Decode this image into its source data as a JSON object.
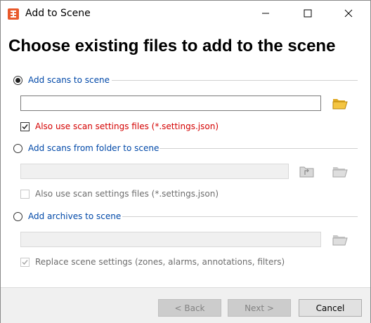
{
  "window": {
    "title": "Add to Scene",
    "app_icon": "app-logo-icon",
    "controls": [
      "minimize-icon",
      "maximize-icon",
      "close-icon"
    ]
  },
  "heading": "Choose existing files to add to the scene",
  "section_scans": {
    "label": "Add scans to scene",
    "selected": true,
    "path_value": "",
    "browse_icon": "folder-open-icon",
    "settings_checkbox": {
      "label": "Also use scan settings files (*.settings.json)",
      "checked": true,
      "enabled": true
    }
  },
  "section_folder": {
    "label": "Add scans from folder to scene",
    "selected": false,
    "path_value": "",
    "parent_icon": "folder-up-icon",
    "browse_icon": "folder-open-icon",
    "settings_checkbox": {
      "label": "Also use scan settings files (*.settings.json)",
      "checked": false,
      "enabled": false
    }
  },
  "section_archives": {
    "label": "Add archives to scene",
    "selected": false,
    "path_value": "",
    "browse_icon": "folder-open-icon",
    "replace_checkbox": {
      "label": "Replace scene settings (zones, alarms, annotations, filters)",
      "checked": true,
      "enabled": false
    }
  },
  "footer": {
    "back_label": "< Back",
    "next_label": "Next >",
    "cancel_label": "Cancel"
  },
  "colors": {
    "link_blue": "#0048a8",
    "warning_red": "#d40000",
    "app_orange": "#e8582a",
    "folder_yellow": "#f4c542"
  }
}
